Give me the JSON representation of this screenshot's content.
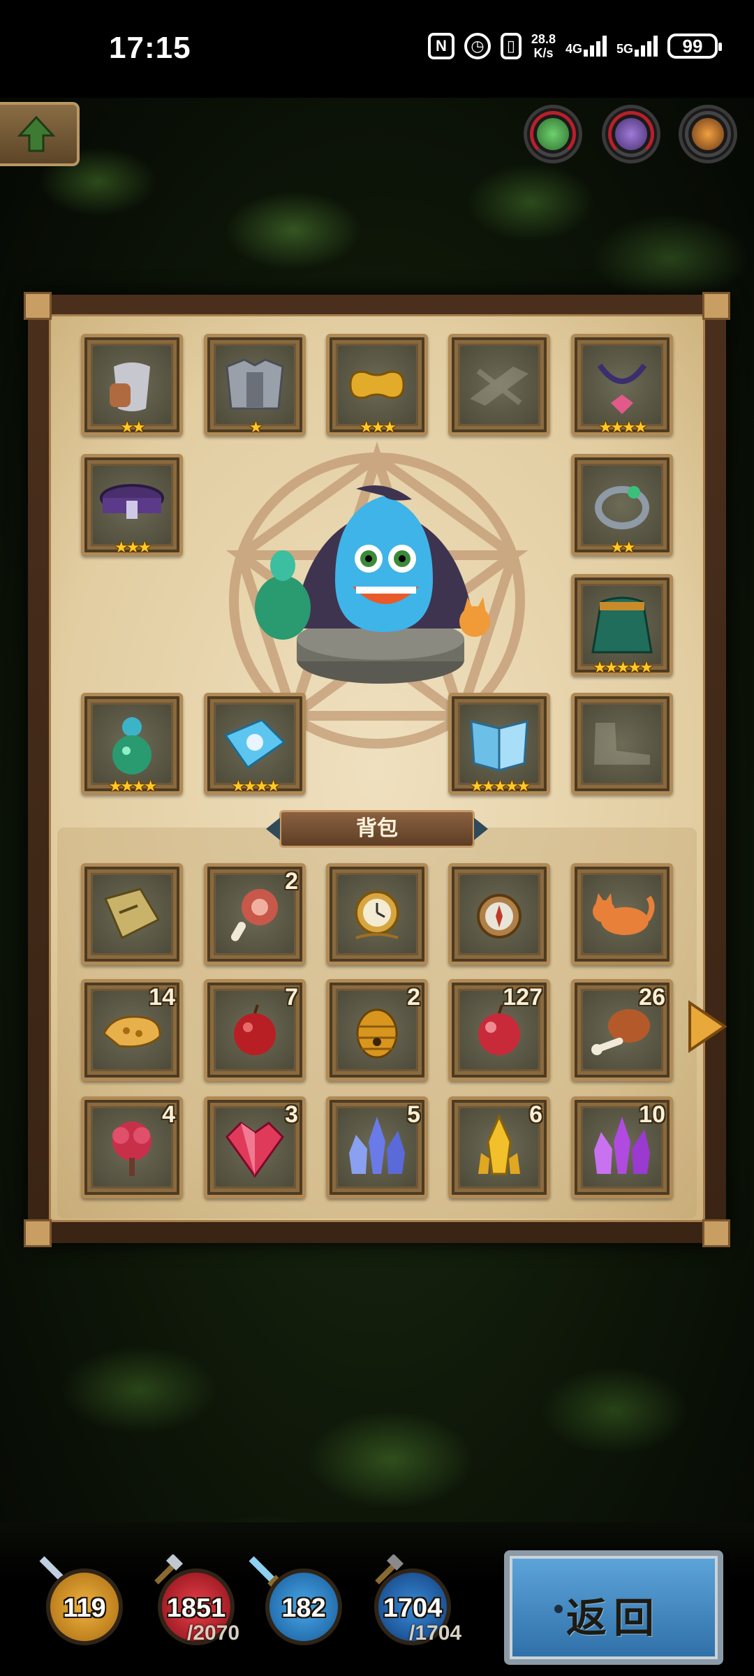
{
  "status_bar": {
    "time": "17:15",
    "speed_value": "28.8",
    "speed_unit": "K/s",
    "net1": "4G",
    "net2": "5G",
    "battery": "99"
  },
  "icons": [
    "nfc-icon",
    "alarm-icon",
    "vibrate-icon",
    "signal-icon",
    "battery-icon",
    "up-arrow-icon",
    "next-arrow-icon"
  ],
  "equipment": [
    {
      "name": "bracers",
      "stars": "★★"
    },
    {
      "name": "armor",
      "stars": "★"
    },
    {
      "name": "gold-bracelet",
      "stars": "★★★"
    },
    {
      "name": "crossbow-empty",
      "stars": ""
    },
    {
      "name": "necklace",
      "stars": "★★★★"
    },
    {
      "name": "belt",
      "stars": "★★★"
    },
    {
      "name": "ring",
      "stars": "★★"
    },
    {
      "name": "cloak",
      "stars": "★★★★★"
    },
    {
      "name": "potion-gourd",
      "stars": "★★★★"
    },
    {
      "name": "map-scroll",
      "stars": "★★★★"
    },
    {
      "name": "spellbook",
      "stars": "★★★★★"
    },
    {
      "name": "boots-empty",
      "stars": ""
    }
  ],
  "backpack": {
    "label": "背包",
    "items": [
      {
        "name": "treasure-map",
        "count": ""
      },
      {
        "name": "ham",
        "count": "2"
      },
      {
        "name": "pocket-watch",
        "count": ""
      },
      {
        "name": "compass",
        "count": ""
      },
      {
        "name": "cat-figurine",
        "count": ""
      },
      {
        "name": "honeycomb",
        "count": "14"
      },
      {
        "name": "red-apple",
        "count": "7"
      },
      {
        "name": "beehive",
        "count": "2"
      },
      {
        "name": "apple",
        "count": "127"
      },
      {
        "name": "meat-leg",
        "count": "26"
      },
      {
        "name": "red-flower",
        "count": "4"
      },
      {
        "name": "red-crystal",
        "count": "3"
      },
      {
        "name": "blue-crystal",
        "count": "5"
      },
      {
        "name": "gold-crystal",
        "count": "6"
      },
      {
        "name": "purple-crystal",
        "count": "10"
      }
    ]
  },
  "hud": {
    "stat1": "119",
    "stat2": "1851",
    "stat2_max": "/2070",
    "stat3": "182",
    "stat4": "1704",
    "stat4_max": "/1704",
    "back_label": "返回"
  },
  "colors": {
    "panel_parchment": "#e2cda1",
    "slot_frame": "#b08a56",
    "star": "#ffc928",
    "back_button": "#3f86c2"
  }
}
